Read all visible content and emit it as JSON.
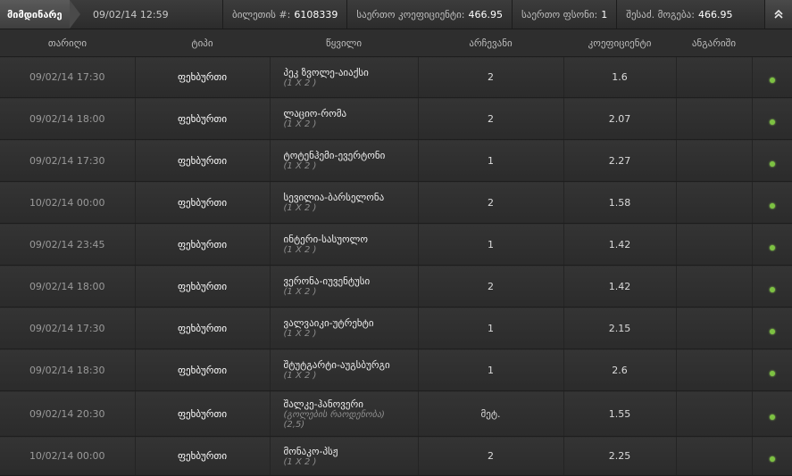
{
  "header": {
    "status_tab": "მიმდინარე",
    "datetime": "09/02/14 12:59",
    "ticket_label": "ბილეთის #:",
    "ticket_number": "6108339",
    "total_coef_label": "საერთო კოეფიციენტი:",
    "total_coef": "466.95",
    "total_stake_label": "საერთო ფსონი:",
    "total_stake": "1",
    "possible_win_label": "შესაძ. მოგება:",
    "possible_win": "466.95",
    "collapse_icon": "double-chevron-up"
  },
  "columns": [
    "თარიღი",
    "ტიპი",
    "წყვილი",
    "არჩევანი",
    "კოეფიციენტი",
    "ანგარიში",
    ""
  ],
  "rows": [
    {
      "date": "09/02/14 17:30",
      "type": "ფეხბურთი",
      "event": "პეკ ზვოლე-აიაქსი",
      "market": "(1 X 2 )",
      "choice": "2",
      "odds": "1.6",
      "score": "",
      "status": "green-dot"
    },
    {
      "date": "09/02/14 18:00",
      "type": "ფეხბურთი",
      "event": "ლაციო-რომა",
      "market": "(1 X 2 )",
      "choice": "2",
      "odds": "2.07",
      "score": "",
      "status": "green-dot"
    },
    {
      "date": "09/02/14 17:30",
      "type": "ფეხბურთი",
      "event": "ტოტენჰემი-ევერტონი",
      "market": "(1 X 2 )",
      "choice": "1",
      "odds": "2.27",
      "score": "",
      "status": "green-dot"
    },
    {
      "date": "10/02/14 00:00",
      "type": "ფეხბურთი",
      "event": "სევილია-ბარსელონა",
      "market": "(1 X 2 )",
      "choice": "2",
      "odds": "1.58",
      "score": "",
      "status": "green-dot"
    },
    {
      "date": "09/02/14 23:45",
      "type": "ფეხბურთი",
      "event": "ინტერი-სასუოლო",
      "market": "(1 X 2 )",
      "choice": "1",
      "odds": "1.42",
      "score": "",
      "status": "green-dot"
    },
    {
      "date": "09/02/14 18:00",
      "type": "ფეხბურთი",
      "event": "ვერონა-იუვენტუსი",
      "market": "(1 X 2 )",
      "choice": "2",
      "odds": "1.42",
      "score": "",
      "status": "green-dot"
    },
    {
      "date": "09/02/14 17:30",
      "type": "ფეხბურთი",
      "event": "ვალვაიკი-უტრეხტი",
      "market": "(1 X 2 )",
      "choice": "1",
      "odds": "2.15",
      "score": "",
      "status": "green-dot"
    },
    {
      "date": "09/02/14 18:30",
      "type": "ფეხბურთი",
      "event": "შტუტგარტი-აუგსბურგი",
      "market": "(1 X 2 )",
      "choice": "1",
      "odds": "2.6",
      "score": "",
      "status": "green-dot"
    },
    {
      "date": "09/02/14 20:30",
      "type": "ფეხბურთი",
      "event": "შალკე-ჰანოვერი",
      "market": "(გოლების რაოდენობა)",
      "market2": "(2,5)",
      "choice": "მეტ.",
      "odds": "1.55",
      "score": "",
      "status": "green-dot"
    },
    {
      "date": "10/02/14 00:00",
      "type": "ფეხბურთი",
      "event": "მონაკო-პსჟ",
      "market": "(1 X 2 )",
      "choice": "2",
      "odds": "2.25",
      "score": "",
      "status": "green-dot"
    }
  ]
}
